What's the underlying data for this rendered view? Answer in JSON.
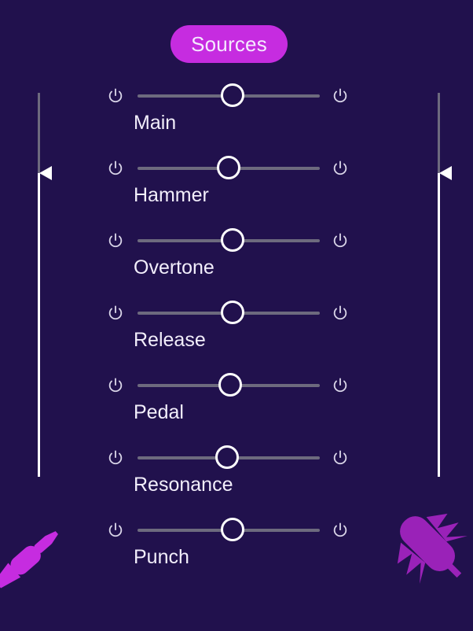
{
  "app": {
    "background_color": "#21114d",
    "accent_color": "#c62ce0",
    "track_color": "#6d6a7e",
    "thumb_color": "#ffffff",
    "text_color": "#f2eefb"
  },
  "header": {
    "title": "Sources"
  },
  "side_sliders": {
    "left": {
      "name": "left-level-slider",
      "value_percent": 79,
      "marker_icon": "triangle-left-icon"
    },
    "right": {
      "name": "right-level-slider",
      "value_percent": 79,
      "marker_icon": "triangle-left-icon"
    }
  },
  "sources": [
    {
      "label": "Main",
      "value_percent": 52,
      "power_left": "power-icon",
      "power_right": "power-icon"
    },
    {
      "label": "Hammer",
      "value_percent": 50,
      "power_left": "power-icon",
      "power_right": "power-icon"
    },
    {
      "label": "Overtone",
      "value_percent": 52,
      "power_left": "power-icon",
      "power_right": "power-icon"
    },
    {
      "label": "Release",
      "value_percent": 52,
      "power_left": "power-icon",
      "power_right": "power-icon"
    },
    {
      "label": "Pedal",
      "value_percent": 51,
      "power_left": "power-icon",
      "power_right": "power-icon"
    },
    {
      "label": "Resonance",
      "value_percent": 49,
      "power_left": "power-icon",
      "power_right": "power-icon"
    },
    {
      "label": "Punch",
      "value_percent": 52,
      "power_left": "power-icon",
      "power_right": "power-icon"
    }
  ],
  "corner_icons": {
    "bottom_left": {
      "name": "audio-jack-icon",
      "color": "#c62ce0"
    },
    "bottom_right": {
      "name": "microphone-icon",
      "color": "#9a22b8"
    }
  }
}
